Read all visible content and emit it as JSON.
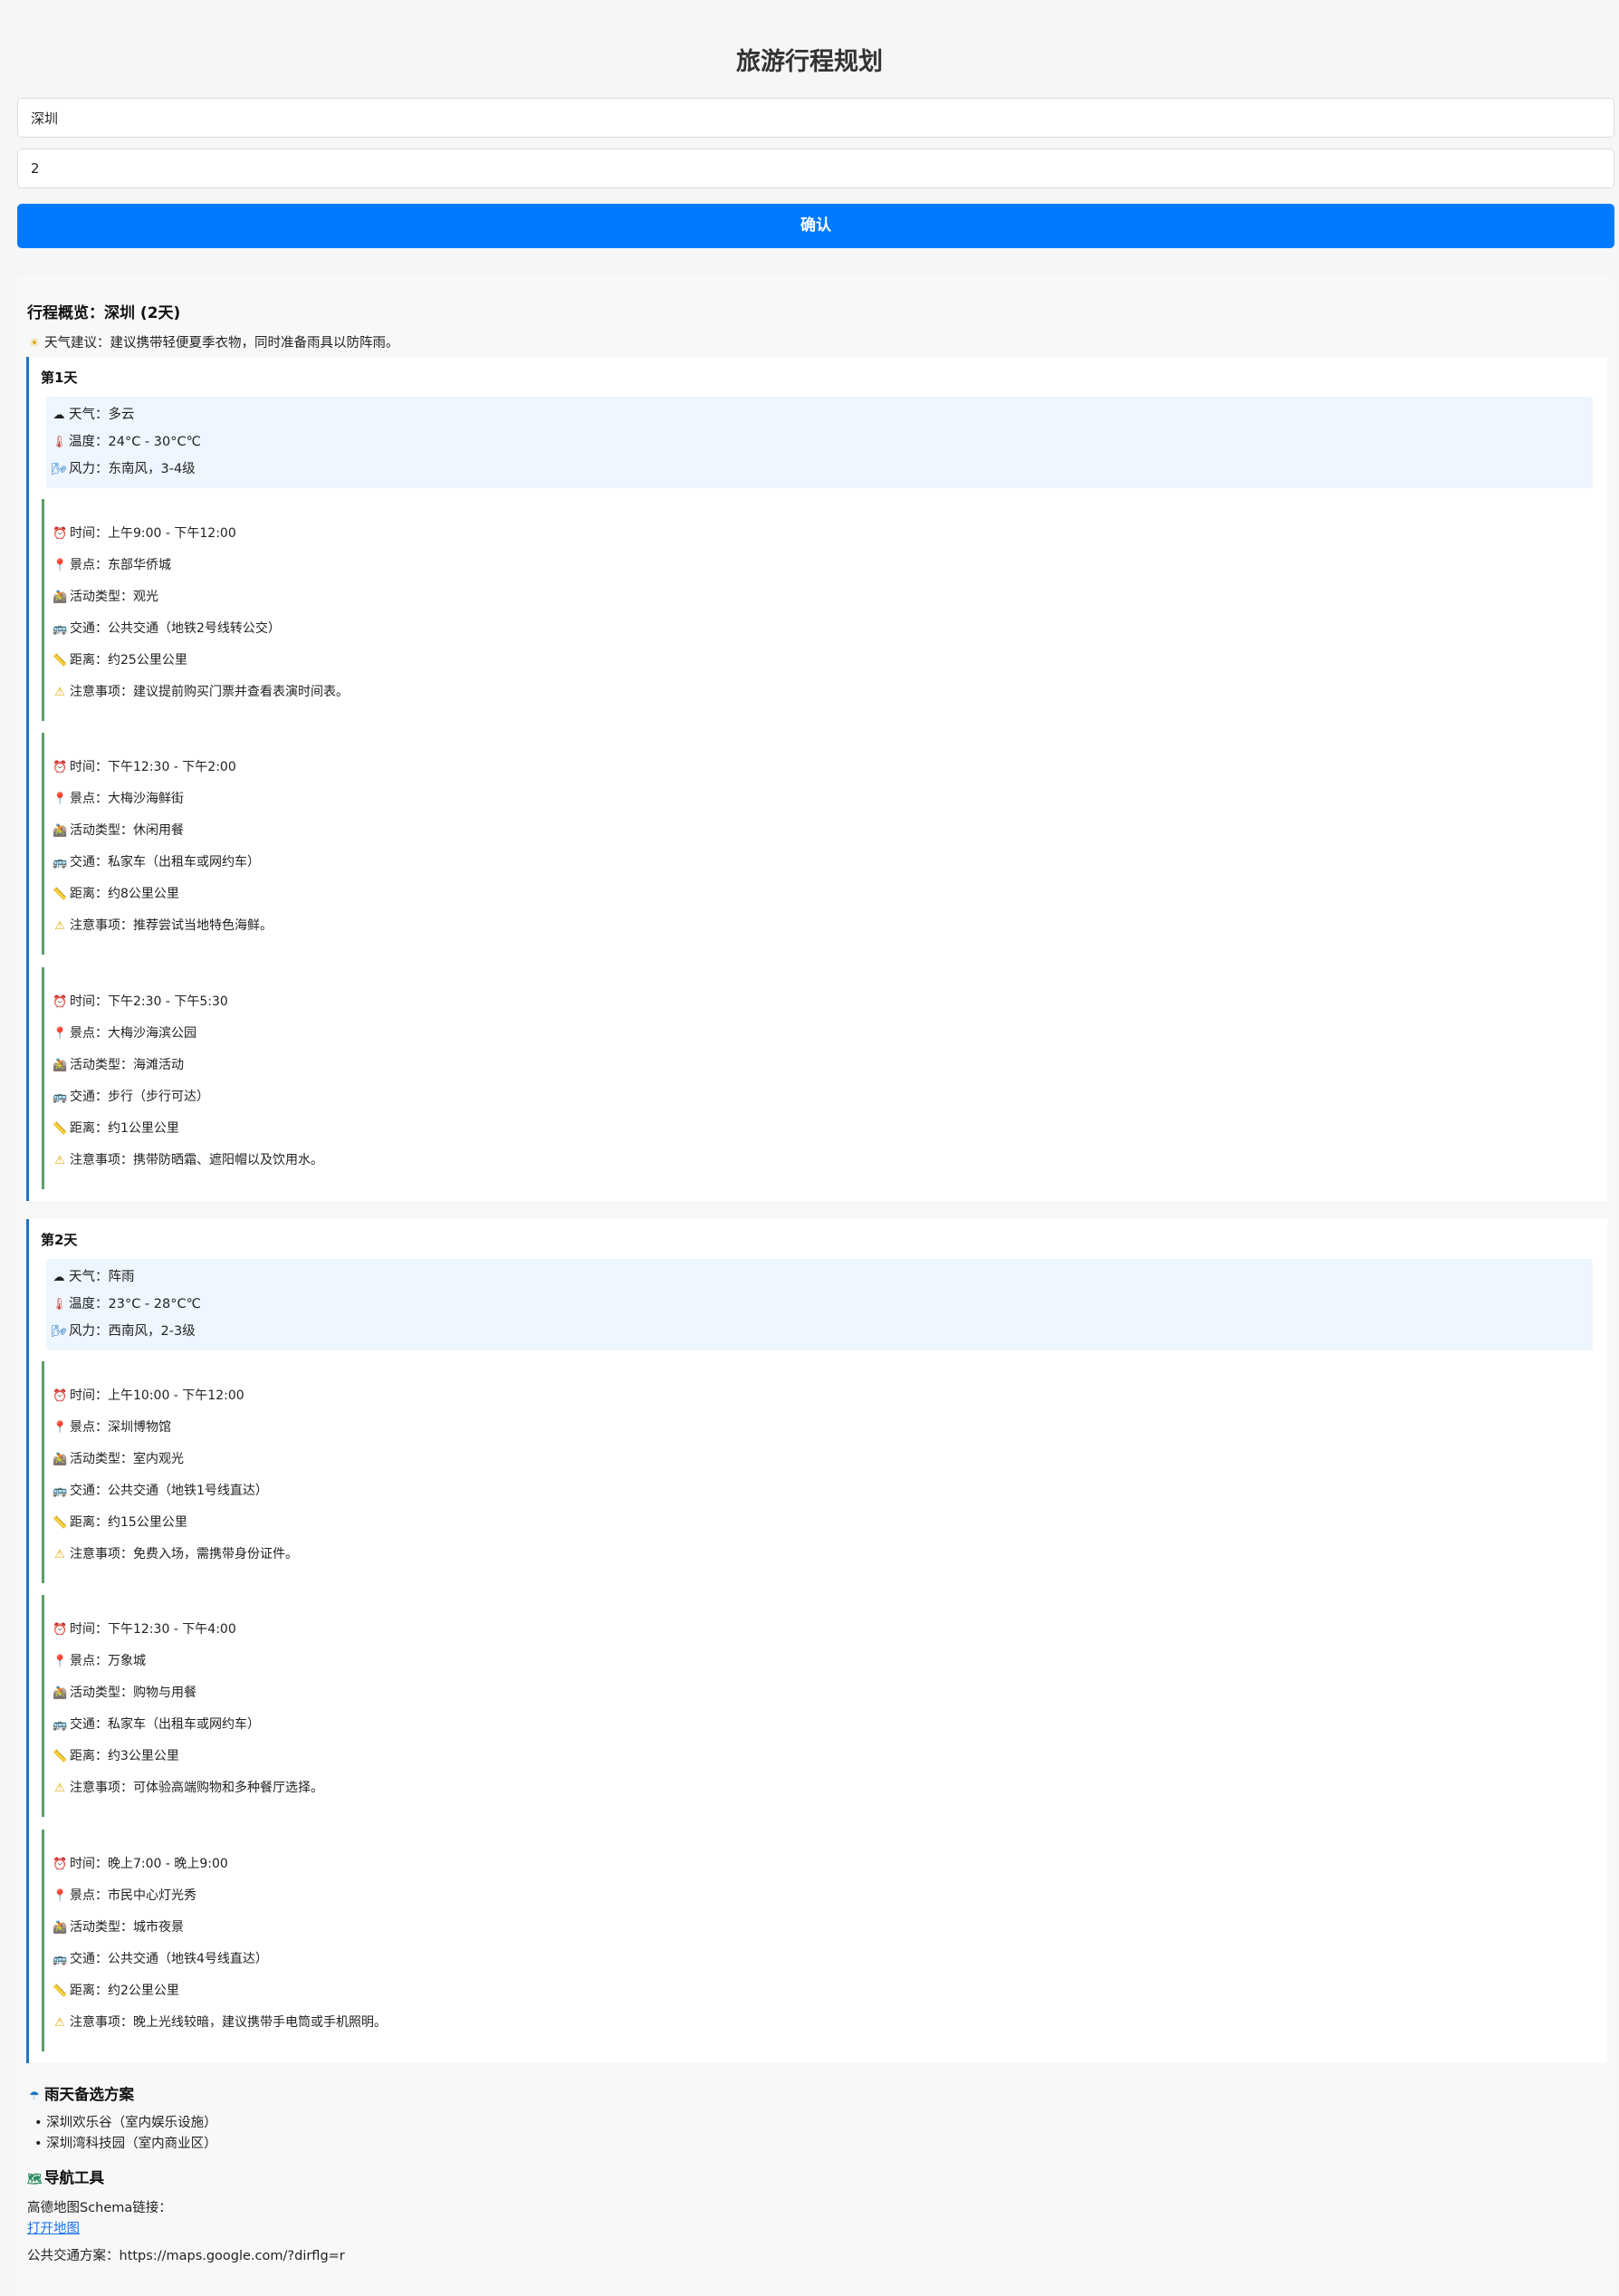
{
  "app": {
    "title": "旅游行程规划"
  },
  "form": {
    "city_value": "深圳",
    "days_value": "2",
    "confirm_label": "确认"
  },
  "overview": {
    "title": "行程概览：深圳 (2天)",
    "tip": "天气建议：建议携带轻便夏季衣物，同时准备雨具以防阵雨。"
  },
  "days": [
    {
      "label": "第1天",
      "weather": {
        "condition": "天气：多云",
        "temperature": "温度：24°C - 30°C℃",
        "wind": "风力：东南风，3-4级"
      },
      "activities": [
        {
          "time": "时间：上午9:00 - 下午12:00",
          "spot": "景点：东部华侨城",
          "type": "活动类型：观光",
          "transport": "交通：公共交通（地铁2号线转公交）",
          "distance": "距离：约25公里公里",
          "note": "注意事项：建议提前购买门票并查看表演时间表。"
        },
        {
          "time": "时间：下午12:30 - 下午2:00",
          "spot": "景点：大梅沙海鲜街",
          "type": "活动类型：休闲用餐",
          "transport": "交通：私家车（出租车或网约车）",
          "distance": "距离：约8公里公里",
          "note": "注意事项：推荐尝试当地特色海鲜。"
        },
        {
          "time": "时间：下午2:30 - 下午5:30",
          "spot": "景点：大梅沙海滨公园",
          "type": "活动类型：海滩活动",
          "transport": "交通：步行（步行可达）",
          "distance": "距离：约1公里公里",
          "note": "注意事项：携带防晒霜、遮阳帽以及饮用水。"
        }
      ]
    },
    {
      "label": "第2天",
      "weather": {
        "condition": "天气：阵雨",
        "temperature": "温度：23°C - 28°C℃",
        "wind": "风力：西南风，2-3级"
      },
      "activities": [
        {
          "time": "时间：上午10:00 - 下午12:00",
          "spot": "景点：深圳博物馆",
          "type": "活动类型：室内观光",
          "transport": "交通：公共交通（地铁1号线直达）",
          "distance": "距离：约15公里公里",
          "note": "注意事项：免费入场，需携带身份证件。"
        },
        {
          "time": "时间：下午12:30 - 下午4:00",
          "spot": "景点：万象城",
          "type": "活动类型：购物与用餐",
          "transport": "交通：私家车（出租车或网约车）",
          "distance": "距离：约3公里公里",
          "note": "注意事项：可体验高端购物和多种餐厅选择。"
        },
        {
          "time": "时间：晚上7:00 - 晚上9:00",
          "spot": "景点：市民中心灯光秀",
          "type": "活动类型：城市夜景",
          "transport": "交通：公共交通（地铁4号线直达）",
          "distance": "距离：约2公里公里",
          "note": "注意事项：晚上光线较暗，建议携带手电筒或手机照明。"
        }
      ]
    }
  ],
  "rain_plan": {
    "title": "雨天备选方案",
    "items": [
      "深圳欢乐谷（室内娱乐设施）",
      "深圳湾科技园（室内商业区）"
    ]
  },
  "navigation": {
    "title": "导航工具",
    "schema_label": "高德地图Schema链接：",
    "open_map_link": "打开地图",
    "transit_text": "公共交通方案：https://maps.google.com/?dirflg=r"
  },
  "icons": {
    "overview_tip": "sun-icon",
    "weather": "cloud-icon",
    "temperature": "thermometer-icon",
    "wind": "wind-icon",
    "time": "alarm-clock-icon",
    "spot": "pin-icon",
    "type": "activity-icon",
    "transport": "bus-icon",
    "distance": "ruler-icon",
    "note": "warning-icon",
    "rain_plan": "umbrella-icon",
    "navigation": "map-icon"
  },
  "colors": {
    "accent": "#007bff",
    "day_border": "#1f73c4",
    "activity_border": "#5aa06a",
    "weather_bg": "#eef6ff",
    "link": "#1a73e8"
  }
}
